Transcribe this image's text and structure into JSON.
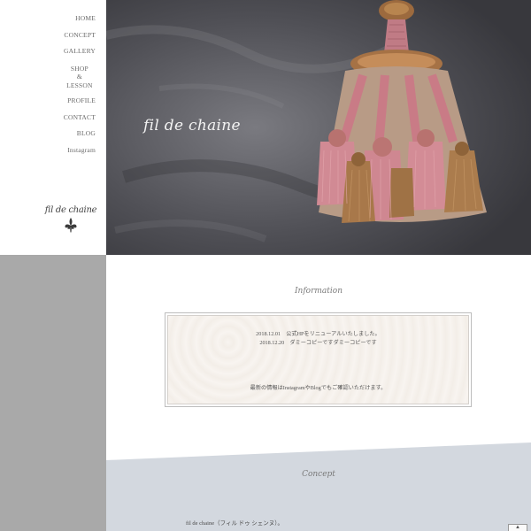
{
  "nav": {
    "items": [
      "HOME",
      "CONCEPT",
      "GALLERY"
    ],
    "shop_lesson": [
      "SHOP",
      "&",
      "LESSON"
    ],
    "items_after": [
      "PROFILE",
      "CONTACT",
      "BLOG",
      "Instagram"
    ]
  },
  "brand": {
    "logo_text": "fil de chaine",
    "hero_title": "fil de chaine"
  },
  "information": {
    "heading": "Information",
    "news": [
      "2018.12.01　公式HPをリニューアルいたしました。",
      "2018.12.20　ダミーコピーですダミーコピーです"
    ],
    "footer_note": "最新の情報はInstagramやBlogでもご確認いただけます。"
  },
  "concept": {
    "heading": "Concept",
    "text": "fil de chaine（フィル ドゥ シェンヌ）。"
  },
  "scroll_top_icon": "chevron-up-icon",
  "colors": {
    "sidebar_gray": "#a9a9a9",
    "concept_band": "#d3d8df",
    "hero_wall": "#4c4c52",
    "tassel_pink": "#c97b86",
    "tassel_gold": "#a8784a"
  }
}
